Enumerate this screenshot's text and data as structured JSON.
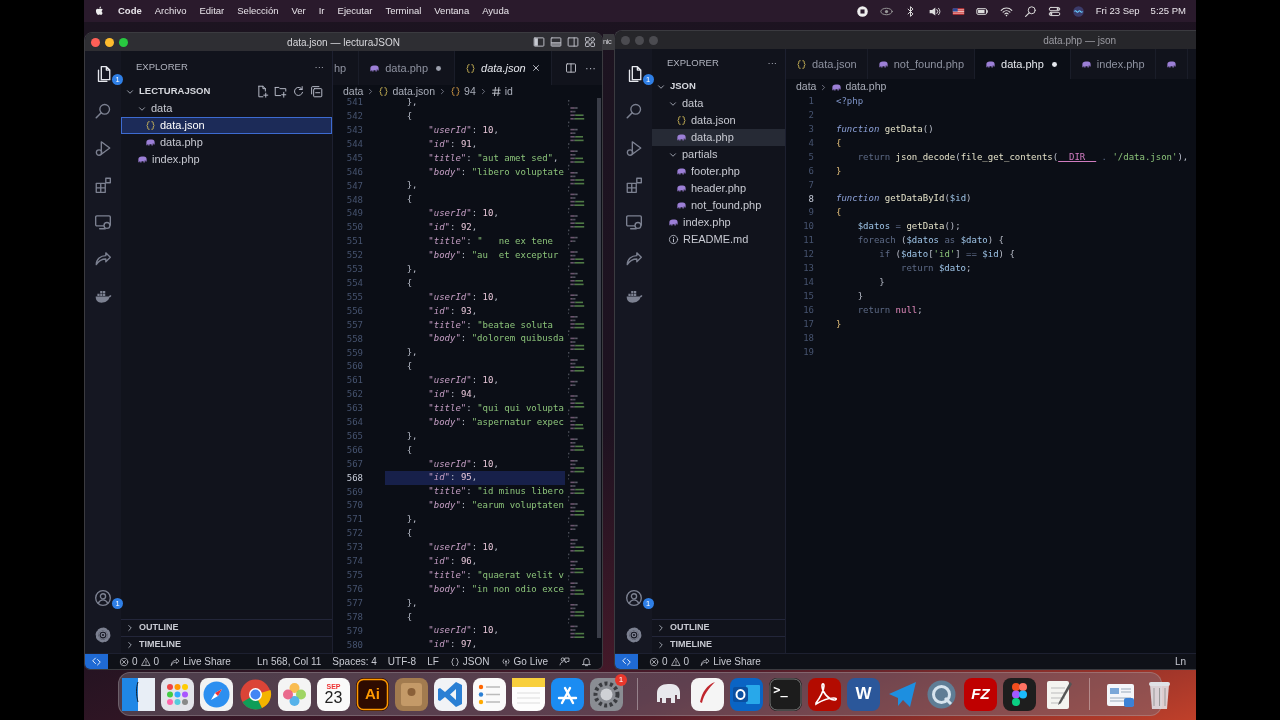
{
  "menu_bar": {
    "menus": [
      {
        "label": "Code",
        "kind": "app"
      },
      {
        "label": "Archivo",
        "kind": "menu"
      },
      {
        "label": "Editar",
        "kind": "menu"
      },
      {
        "label": "Selección",
        "kind": "menu"
      },
      {
        "label": "Ver",
        "kind": "menu"
      },
      {
        "label": "Ir",
        "kind": "menu"
      },
      {
        "label": "Ejecutar",
        "kind": "menu"
      },
      {
        "label": "Terminal",
        "kind": "menu"
      },
      {
        "label": "Ventana",
        "kind": "menu"
      },
      {
        "label": "Ayuda",
        "kind": "menu"
      }
    ],
    "status_icons": [
      {
        "kind": "record"
      },
      {
        "kind": "eye"
      },
      {
        "kind": "bluetooth"
      },
      {
        "kind": "volume"
      },
      {
        "kind": "flag"
      },
      {
        "kind": "battery"
      },
      {
        "kind": "wifi"
      },
      {
        "kind": "search"
      },
      {
        "kind": "control"
      },
      {
        "kind": "siri"
      }
    ],
    "date": "Fri 23 Sep",
    "time": "5:25 PM"
  },
  "windows": [
    {
      "title": "data.json — lecturaJSON",
      "focused": true,
      "layout_icons": [
        {
          "kind": "sidebar"
        },
        {
          "kind": "panel"
        },
        {
          "kind": "secondary"
        },
        {
          "kind": "customize"
        }
      ],
      "activity_bar": {
        "items": [
          {
            "kind": "explorer",
            "selected": true,
            "badge": "1"
          },
          {
            "kind": "search",
            "selected": false
          },
          {
            "kind": "debug",
            "selected": false
          },
          {
            "kind": "extensions",
            "selected": false
          },
          {
            "kind": "remote",
            "selected": false
          },
          {
            "kind": "liveshare",
            "selected": false
          },
          {
            "kind": "docker",
            "selected": false
          }
        ],
        "bottom": [
          {
            "kind": "account",
            "badge": "1"
          },
          {
            "kind": "settings"
          }
        ]
      },
      "sidebar": {
        "header": "EXPLORER",
        "more": "···",
        "root": {
          "label": "LECTURAJSON",
          "expanded": true,
          "actions": [
            {
              "kind": "new_file"
            },
            {
              "kind": "new_folder"
            },
            {
              "kind": "refresh"
            },
            {
              "kind": "collapse"
            }
          ]
        },
        "tree": [
          {
            "label": "data",
            "kind": "folder",
            "expanded": true,
            "selected": false,
            "children": [
              {
                "label": "data.json",
                "kind": "json",
                "selected": true
              },
              {
                "label": "data.php",
                "kind": "php",
                "selected": false
              }
            ]
          },
          {
            "label": "index.php",
            "kind": "php",
            "selected": false
          }
        ],
        "panels": [
          {
            "label": "OUTLINE",
            "expanded": false
          },
          {
            "label": "TIMELINE",
            "expanded": false
          }
        ]
      },
      "tabs": [
        {
          "label": "hp",
          "selected": false,
          "modified": false,
          "preview": false
        },
        {
          "label": "data.php",
          "kind": "php",
          "selected": false,
          "modified": true,
          "preview": false
        },
        {
          "label": "data.json",
          "kind": "json",
          "selected": true,
          "modified": false,
          "preview": true
        }
      ],
      "editor_actions": [
        {
          "kind": "split"
        },
        {
          "kind": "more",
          "label": "···"
        }
      ],
      "breadcrumb": [
        {
          "label": "data"
        },
        {
          "label": "data.json",
          "kind": "json"
        },
        {
          "label": "94",
          "kind": "object"
        },
        {
          "label": "id",
          "kind": "number"
        }
      ],
      "minimap": true,
      "code": {
        "lines": [
          {
            "n": "541",
            "current": false,
            "tokens": [
              {
                "kind": "punc",
                "text": "    },"
              }
            ]
          },
          {
            "n": "542",
            "current": false,
            "tokens": [
              {
                "kind": "punc",
                "text": "    {"
              }
            ]
          },
          {
            "n": "543",
            "current": false,
            "tokens": [
              {
                "kind": "key",
                "text": "        \"userId\""
              },
              {
                "kind": "punc",
                "text": ": "
              },
              {
                "kind": "num",
                "text": "10"
              },
              {
                "kind": "punc",
                "text": ","
              }
            ]
          },
          {
            "n": "544",
            "current": false,
            "tokens": [
              {
                "kind": "key",
                "text": "        \"id\""
              },
              {
                "kind": "punc",
                "text": ": "
              },
              {
                "kind": "num",
                "text": "91"
              },
              {
                "kind": "punc",
                "text": ","
              }
            ]
          },
          {
            "n": "545",
            "current": false,
            "tokens": [
              {
                "kind": "key",
                "text": "        \"title\""
              },
              {
                "kind": "punc",
                "text": ": "
              },
              {
                "kind": "str",
                "text": "\"aut amet sed\""
              },
              {
                "kind": "punc",
                "text": ","
              }
            ]
          },
          {
            "n": "546",
            "current": false,
            "tokens": [
              {
                "kind": "key",
                "text": "        \"body\""
              },
              {
                "kind": "punc",
                "text": ": "
              },
              {
                "kind": "str",
                "text": "\"libero voluptate"
              }
            ]
          },
          {
            "n": "547",
            "current": false,
            "tokens": [
              {
                "kind": "punc",
                "text": "    },"
              }
            ]
          },
          {
            "n": "548",
            "current": false,
            "tokens": [
              {
                "kind": "punc",
                "text": "    {"
              }
            ]
          },
          {
            "n": "549",
            "current": false,
            "tokens": [
              {
                "kind": "key",
                "text": "        \"userId\""
              },
              {
                "kind": "punc",
                "text": ": "
              },
              {
                "kind": "num",
                "text": "10"
              },
              {
                "kind": "punc",
                "text": ","
              }
            ]
          },
          {
            "n": "550",
            "current": false,
            "tokens": [
              {
                "kind": "key",
                "text": "        \"id\""
              },
              {
                "kind": "punc",
                "text": ": "
              },
              {
                "kind": "num",
                "text": "92"
              },
              {
                "kind": "punc",
                "text": ","
              }
            ]
          },
          {
            "n": "551",
            "current": false,
            "tokens": [
              {
                "kind": "key",
                "text": "        \"title\""
              },
              {
                "kind": "punc",
                "text": ": "
              },
              {
                "kind": "str",
                "text": "\"   ne ex tene"
              }
            ]
          },
          {
            "n": "552",
            "current": false,
            "tokens": [
              {
                "kind": "key",
                "text": "        \"body\""
              },
              {
                "kind": "punc",
                "text": ": "
              },
              {
                "kind": "str",
                "text": "\"au  et exceptur"
              }
            ]
          },
          {
            "n": "553",
            "current": false,
            "tokens": [
              {
                "kind": "punc",
                "text": "    },"
              }
            ]
          },
          {
            "n": "554",
            "current": false,
            "tokens": [
              {
                "kind": "punc",
                "text": "    {"
              }
            ]
          },
          {
            "n": "555",
            "current": false,
            "tokens": [
              {
                "kind": "key",
                "text": "        \"userId\""
              },
              {
                "kind": "punc",
                "text": ": "
              },
              {
                "kind": "num",
                "text": "10"
              },
              {
                "kind": "punc",
                "text": ","
              }
            ]
          },
          {
            "n": "556",
            "current": false,
            "tokens": [
              {
                "kind": "key",
                "text": "        \"id\""
              },
              {
                "kind": "punc",
                "text": ": "
              },
              {
                "kind": "num",
                "text": "93"
              },
              {
                "kind": "punc",
                "text": ","
              }
            ]
          },
          {
            "n": "557",
            "current": false,
            "tokens": [
              {
                "kind": "key",
                "text": "        \"title\""
              },
              {
                "kind": "punc",
                "text": ": "
              },
              {
                "kind": "str",
                "text": "\"beatae soluta"
              }
            ]
          },
          {
            "n": "558",
            "current": false,
            "tokens": [
              {
                "kind": "key",
                "text": "        \"body\""
              },
              {
                "kind": "punc",
                "text": ": "
              },
              {
                "kind": "str",
                "text": "\"dolorem quibusda"
              }
            ]
          },
          {
            "n": "559",
            "current": false,
            "tokens": [
              {
                "kind": "punc",
                "text": "    },"
              }
            ]
          },
          {
            "n": "560",
            "current": false,
            "tokens": [
              {
                "kind": "punc",
                "text": "    {"
              }
            ]
          },
          {
            "n": "561",
            "current": false,
            "tokens": [
              {
                "kind": "key",
                "text": "        \"userId\""
              },
              {
                "kind": "punc",
                "text": ": "
              },
              {
                "kind": "num",
                "text": "10"
              },
              {
                "kind": "punc",
                "text": ","
              }
            ]
          },
          {
            "n": "562",
            "current": false,
            "tokens": [
              {
                "kind": "key",
                "text": "        \"id\""
              },
              {
                "kind": "punc",
                "text": ": "
              },
              {
                "kind": "num",
                "text": "94"
              },
              {
                "kind": "punc",
                "text": ","
              }
            ]
          },
          {
            "n": "563",
            "current": false,
            "tokens": [
              {
                "kind": "key",
                "text": "        \"title\""
              },
              {
                "kind": "punc",
                "text": ": "
              },
              {
                "kind": "str",
                "text": "\"qui qui volupta"
              }
            ]
          },
          {
            "n": "564",
            "current": false,
            "tokens": [
              {
                "kind": "key",
                "text": "        \"body\""
              },
              {
                "kind": "punc",
                "text": ": "
              },
              {
                "kind": "str",
                "text": "\"aspernatur expec"
              }
            ]
          },
          {
            "n": "565",
            "current": false,
            "tokens": [
              {
                "kind": "punc",
                "text": "    },"
              }
            ]
          },
          {
            "n": "566",
            "current": false,
            "tokens": [
              {
                "kind": "punc",
                "text": "    {"
              }
            ]
          },
          {
            "n": "567",
            "current": false,
            "tokens": [
              {
                "kind": "key",
                "text": "        \"userId\""
              },
              {
                "kind": "punc",
                "text": ": "
              },
              {
                "kind": "num",
                "text": "10"
              },
              {
                "kind": "punc",
                "text": ","
              }
            ]
          },
          {
            "n": "568",
            "current": true,
            "tokens": [
              {
                "kind": "key",
                "text": "        \"id\""
              },
              {
                "kind": "punc",
                "text": ": "
              },
              {
                "kind": "num",
                "text": "95"
              },
              {
                "kind": "punc",
                "text": ","
              }
            ]
          },
          {
            "n": "569",
            "current": false,
            "tokens": [
              {
                "kind": "key",
                "text": "        \"title\""
              },
              {
                "kind": "punc",
                "text": ": "
              },
              {
                "kind": "str",
                "text": "\"id minus libero"
              }
            ]
          },
          {
            "n": "570",
            "current": false,
            "tokens": [
              {
                "kind": "key",
                "text": "        \"body\""
              },
              {
                "kind": "punc",
                "text": ": "
              },
              {
                "kind": "str",
                "text": "\"earum voluptaten"
              }
            ]
          },
          {
            "n": "571",
            "current": false,
            "tokens": [
              {
                "kind": "punc",
                "text": "    },"
              }
            ]
          },
          {
            "n": "572",
            "current": false,
            "tokens": [
              {
                "kind": "punc",
                "text": "    {"
              }
            ]
          },
          {
            "n": "573",
            "current": false,
            "tokens": [
              {
                "kind": "key",
                "text": "        \"userId\""
              },
              {
                "kind": "punc",
                "text": ": "
              },
              {
                "kind": "num",
                "text": "10"
              },
              {
                "kind": "punc",
                "text": ","
              }
            ]
          },
          {
            "n": "574",
            "current": false,
            "tokens": [
              {
                "kind": "key",
                "text": "        \"id\""
              },
              {
                "kind": "punc",
                "text": ": "
              },
              {
                "kind": "num",
                "text": "96"
              },
              {
                "kind": "punc",
                "text": ","
              }
            ]
          },
          {
            "n": "575",
            "current": false,
            "tokens": [
              {
                "kind": "key",
                "text": "        \"title\""
              },
              {
                "kind": "punc",
                "text": ": "
              },
              {
                "kind": "str",
                "text": "\"quaerat velit v"
              }
            ]
          },
          {
            "n": "576",
            "current": false,
            "tokens": [
              {
                "kind": "key",
                "text": "        \"body\""
              },
              {
                "kind": "punc",
                "text": ": "
              },
              {
                "kind": "str",
                "text": "\"in non odio exce"
              }
            ]
          },
          {
            "n": "577",
            "current": false,
            "tokens": [
              {
                "kind": "punc",
                "text": "    },"
              }
            ]
          },
          {
            "n": "578",
            "current": false,
            "tokens": [
              {
                "kind": "punc",
                "text": "    {"
              }
            ]
          },
          {
            "n": "579",
            "current": false,
            "tokens": [
              {
                "kind": "key",
                "text": "        \"userId\""
              },
              {
                "kind": "punc",
                "text": ": "
              },
              {
                "kind": "num",
                "text": "10"
              },
              {
                "kind": "punc",
                "text": ","
              }
            ]
          },
          {
            "n": "580",
            "current": false,
            "tokens": [
              {
                "kind": "key",
                "text": "        \"id\""
              },
              {
                "kind": "punc",
                "text": ": "
              },
              {
                "kind": "num",
                "text": "97"
              },
              {
                "kind": "punc",
                "text": ","
              }
            ]
          }
        ]
      },
      "status_bar": {
        "items": [
          {
            "kind": "remote"
          },
          {
            "kind": "problems",
            "errors": "0",
            "warnings": "0"
          },
          {
            "kind": "liveshare",
            "label": "Live Share"
          },
          {
            "kind": "position",
            "label": "Ln 568, Col 11"
          },
          {
            "kind": "text",
            "label": "Spaces: 4"
          },
          {
            "kind": "text",
            "label": "UTF-8"
          },
          {
            "kind": "text",
            "label": "LF"
          },
          {
            "kind": "language",
            "label": "JSON"
          },
          {
            "kind": "golive",
            "label": "Go Live"
          },
          {
            "kind": "feedback"
          },
          {
            "kind": "notifications"
          }
        ]
      }
    },
    {
      "title": "data.php — json",
      "focused": false,
      "activity_bar": {
        "items": [
          {
            "kind": "explorer",
            "selected": true,
            "badge": "1"
          },
          {
            "kind": "search",
            "selected": false
          },
          {
            "kind": "debug",
            "selected": false
          },
          {
            "kind": "extensions",
            "selected": false
          },
          {
            "kind": "remote",
            "selected": false
          },
          {
            "kind": "liveshare",
            "selected": false
          },
          {
            "kind": "docker",
            "selected": false
          }
        ],
        "bottom": [
          {
            "kind": "account",
            "badge": "1"
          },
          {
            "kind": "settings"
          }
        ]
      },
      "sidebar": {
        "header": "EXPLORER",
        "more": "···",
        "root": {
          "label": "JSON",
          "expanded": true
        },
        "tree": [
          {
            "label": "data",
            "kind": "folder",
            "expanded": true,
            "selected": false,
            "children": [
              {
                "label": "data.json",
                "kind": "json",
                "selected": false
              },
              {
                "label": "data.php",
                "kind": "php",
                "selected": true
              }
            ]
          },
          {
            "label": "partials",
            "kind": "folder",
            "expanded": true,
            "selected": false,
            "children": [
              {
                "label": "footer.php",
                "kind": "php",
                "selected": false
              },
              {
                "label": "header.php",
                "kind": "php",
                "selected": false
              },
              {
                "label": "not_found.php",
                "kind": "php",
                "selected": false
              }
            ]
          },
          {
            "label": "index.php",
            "kind": "php",
            "selected": false
          },
          {
            "label": "README.md",
            "kind": "info",
            "selected": false
          }
        ],
        "panels": [
          {
            "label": "OUTLINE",
            "expanded": false
          },
          {
            "label": "TIMELINE",
            "expanded": false
          }
        ]
      },
      "tabs": [
        {
          "label": "data.json",
          "kind": "json",
          "selected": false,
          "modified": false,
          "preview": false
        },
        {
          "label": "not_found.php",
          "kind": "php",
          "selected": false,
          "modified": false,
          "preview": false
        },
        {
          "label": "data.php",
          "kind": "php",
          "selected": true,
          "modified": true,
          "preview": false
        },
        {
          "label": "index.php",
          "kind": "php",
          "selected": false,
          "modified": false,
          "preview": false
        },
        {
          "kind": "php",
          "selected": false
        }
      ],
      "breadcrumb": [
        {
          "label": "data"
        },
        {
          "label": "data.php",
          "kind": "php"
        }
      ],
      "code": {
        "lines": [
          {
            "n": "1",
            "current": false,
            "tokens": [
              {
                "kind": "tag",
                "text": "<?php"
              }
            ]
          },
          {
            "n": "2",
            "current": false
          },
          {
            "n": "3",
            "current": false,
            "tokens": [
              {
                "kind": "kw",
                "text": "function"
              },
              {
                "kind": "fn",
                "text": " getData"
              },
              {
                "kind": "punc",
                "text": "()"
              }
            ]
          },
          {
            "n": "4",
            "current": false,
            "tokens": [
              {
                "kind": "brace",
                "text": "{"
              }
            ]
          },
          {
            "n": "5",
            "current": false,
            "tokens": [
              {
                "kind": "ctl",
                "text": "    return"
              },
              {
                "kind": "fn",
                "text": " json_decode"
              },
              {
                "kind": "punc",
                "text": "("
              },
              {
                "kind": "fn",
                "text": "file_get_contents"
              },
              {
                "kind": "punc",
                "text": "("
              },
              {
                "kind": "const",
                "text": "__DIR__"
              },
              {
                "kind": "ctl",
                "text": " . "
              },
              {
                "kind": "str",
                "text": "'/data.json'"
              },
              {
                "kind": "punc",
                "text": "),"
              }
            ]
          },
          {
            "n": "6",
            "current": false,
            "tokens": [
              {
                "kind": "brace",
                "text": "}"
              }
            ]
          },
          {
            "n": "7",
            "current": false
          },
          {
            "n": "8",
            "current": true,
            "tokens": [
              {
                "kind": "kw",
                "text": "function"
              },
              {
                "kind": "fn",
                "text": " getDataById"
              },
              {
                "kind": "punc",
                "text": "("
              },
              {
                "kind": "var",
                "text": "$id"
              },
              {
                "kind": "punc",
                "text": ")"
              }
            ]
          },
          {
            "n": "9",
            "current": false,
            "tokens": [
              {
                "kind": "brace",
                "text": "{"
              }
            ]
          },
          {
            "n": "10",
            "current": false,
            "tokens": [
              {
                "kind": "var",
                "text": "    $datos"
              },
              {
                "kind": "ctl",
                "text": " = "
              },
              {
                "kind": "fn",
                "text": "getData"
              },
              {
                "kind": "punc",
                "text": "();"
              }
            ]
          },
          {
            "n": "11",
            "current": false,
            "tokens": [
              {
                "kind": "ctl",
                "text": "    foreach"
              },
              {
                "kind": "punc",
                "text": " ("
              },
              {
                "kind": "var",
                "text": "$datos"
              },
              {
                "kind": "ctl",
                "text": " as "
              },
              {
                "kind": "var",
                "text": "$dato"
              },
              {
                "kind": "punc",
                "text": ") {"
              }
            ]
          },
          {
            "n": "12",
            "current": false,
            "tokens": [
              {
                "kind": "ctl",
                "text": "        if"
              },
              {
                "kind": "punc",
                "text": " ("
              },
              {
                "kind": "var",
                "text": "$dato"
              },
              {
                "kind": "punc",
                "text": "["
              },
              {
                "kind": "str",
                "text": "'id'"
              },
              {
                "kind": "punc",
                "text": "]"
              },
              {
                "kind": "ctl",
                "text": " == "
              },
              {
                "kind": "var",
                "text": "$id"
              },
              {
                "kind": "punc",
                "text": ") {"
              }
            ]
          },
          {
            "n": "13",
            "current": false,
            "tokens": [
              {
                "kind": "ctl",
                "text": "            return"
              },
              {
                "kind": "var",
                "text": " $dato"
              },
              {
                "kind": "punc",
                "text": ";"
              }
            ]
          },
          {
            "n": "14",
            "current": false,
            "tokens": [
              {
                "kind": "punc",
                "text": "        }"
              }
            ]
          },
          {
            "n": "15",
            "current": false,
            "tokens": [
              {
                "kind": "punc",
                "text": "    }"
              }
            ]
          },
          {
            "n": "16",
            "current": false,
            "tokens": [
              {
                "kind": "ctl",
                "text": "    return"
              },
              {
                "kind": "nul",
                "text": " null"
              },
              {
                "kind": "punc",
                "text": ";"
              }
            ]
          },
          {
            "n": "17",
            "current": false,
            "tokens": [
              {
                "kind": "brace",
                "text": "}"
              }
            ]
          },
          {
            "n": "18",
            "current": false
          },
          {
            "n": "19",
            "current": false
          }
        ]
      },
      "status_bar": {
        "items": [
          {
            "kind": "remote"
          },
          {
            "kind": "problems",
            "errors": "0",
            "warnings": "0"
          },
          {
            "kind": "liveshare",
            "label": "Live Share"
          },
          {
            "kind": "position",
            "label": "Ln"
          }
        ]
      }
    }
  ],
  "background_window": {
    "title": "nic"
  },
  "dock": {
    "items": [
      {
        "kind": "finder"
      },
      {
        "kind": "launchpad"
      },
      {
        "kind": "safari"
      },
      {
        "kind": "chrome"
      },
      {
        "kind": "photos"
      },
      {
        "kind": "calendar",
        "month": "SEP",
        "day": "23"
      },
      {
        "kind": "illustrator",
        "glyph": "Ai"
      },
      {
        "kind": "contacts"
      },
      {
        "kind": "vscode"
      },
      {
        "kind": "reminders"
      },
      {
        "kind": "notes"
      },
      {
        "kind": "appstore"
      },
      {
        "kind": "settings",
        "badge": "1"
      },
      {
        "kind": "separator"
      },
      {
        "kind": "elephant"
      },
      {
        "kind": "quill"
      },
      {
        "kind": "outlook"
      },
      {
        "kind": "terminal",
        "glyph": ">_"
      },
      {
        "kind": "acrobat"
      },
      {
        "kind": "word",
        "glyph": "W"
      },
      {
        "kind": "plane"
      },
      {
        "kind": "quicktime"
      },
      {
        "kind": "filezilla",
        "glyph": "FZ"
      },
      {
        "kind": "figma"
      },
      {
        "kind": "textedit"
      },
      {
        "kind": "separator"
      },
      {
        "kind": "preview"
      },
      {
        "kind": "trash"
      }
    ]
  }
}
